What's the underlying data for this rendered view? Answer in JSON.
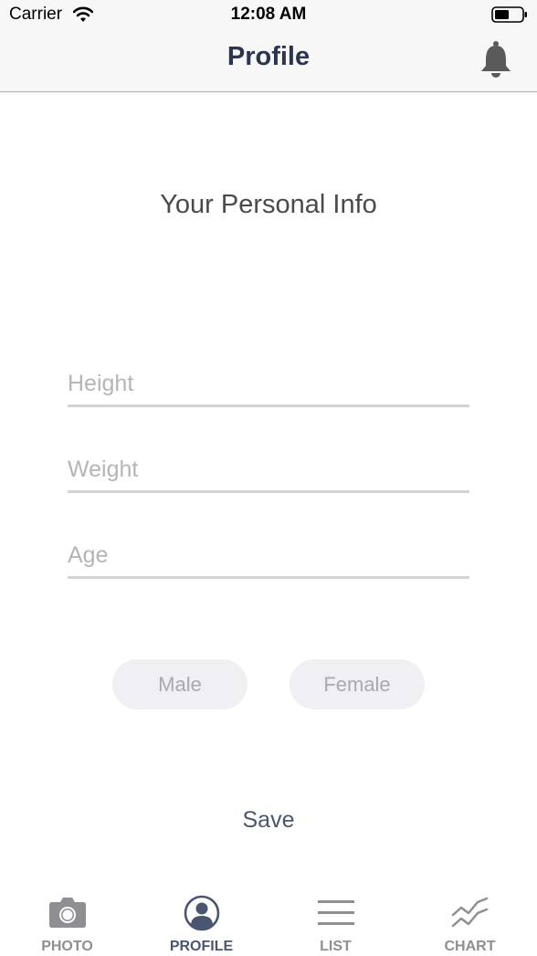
{
  "status_bar": {
    "carrier": "Carrier",
    "time": "12:08 AM",
    "battery_icon": "battery-icon",
    "wifi_icon": "wifi-icon"
  },
  "nav": {
    "title": "Profile",
    "right_icon": "bell-icon"
  },
  "content": {
    "heading": "Your Personal Info",
    "fields": {
      "height": {
        "placeholder": "Height",
        "value": ""
      },
      "weight": {
        "placeholder": "Weight",
        "value": ""
      },
      "age": {
        "placeholder": "Age",
        "value": ""
      }
    },
    "gender": {
      "male_label": "Male",
      "female_label": "Female"
    },
    "save_label": "Save"
  },
  "tabbar": {
    "active_tab": "PROFILE",
    "tabs": [
      {
        "label": "PHOTO",
        "icon": "camera-icon"
      },
      {
        "label": "PROFILE",
        "icon": "user-icon"
      },
      {
        "label": "LIST",
        "icon": "list-icon"
      },
      {
        "label": "CHART",
        "icon": "chart-icon"
      }
    ]
  },
  "colors": {
    "title": "#2b3550",
    "accent": "#4a5670",
    "inactive": "#8e8e93",
    "pill_bg": "#efeff4",
    "pill_text": "#a9a9ae",
    "divider": "#d3d3d3"
  }
}
